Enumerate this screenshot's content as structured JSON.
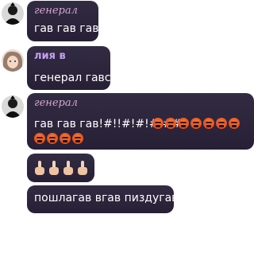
{
  "messages": [
    {
      "author": "генерал",
      "text": "гав гав гав"
    },
    {
      "author": "лия в",
      "text": "генерал гавс"
    },
    {
      "author": "генерал",
      "text": "гав гав гав!#!!#!#!#!##",
      "angry_emoji_line1": 7,
      "angry_emoji_line2": 4
    },
    {
      "author": "",
      "text": "",
      "middle_finger_emoji_count": 4
    },
    {
      "author": "",
      "text": "пошлагав вгав пиздугав"
    }
  ],
  "colors": {
    "bubble": "#2d2640",
    "author_general": "#d5a6cf",
    "author_lia": "#c4a0f0",
    "text": "#ffffff"
  }
}
